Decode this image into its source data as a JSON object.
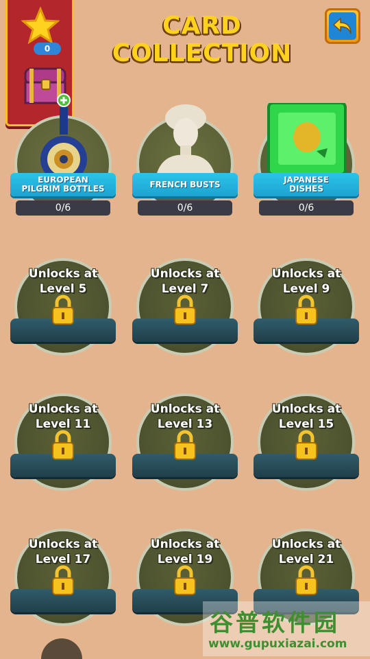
{
  "header": {
    "title_line1": "CARD",
    "title_line2": "COLLECTION",
    "back_icon": "back-arrow-icon"
  },
  "banner": {
    "star_count": "0",
    "chest_icon": "treasure-chest-icon"
  },
  "collections": [
    {
      "name_line1": "EUROPEAN",
      "name_line2": "PILGRIM BOTTLES",
      "progress": "0/6",
      "art": "pilgrim-bottle"
    },
    {
      "name_line1": "FRENCH BUSTS",
      "name_line2": "",
      "progress": "0/6",
      "art": "bust"
    },
    {
      "name_line1": "JAPANESE",
      "name_line2": "DISHES",
      "progress": "0/6",
      "art": "green-dish"
    }
  ],
  "locked": [
    {
      "line1": "Unlocks at",
      "line2": "Level 5"
    },
    {
      "line1": "Unlocks at",
      "line2": "Level 7"
    },
    {
      "line1": "Unlocks at",
      "line2": "Level 9"
    },
    {
      "line1": "Unlocks at",
      "line2": "Level 11"
    },
    {
      "line1": "Unlocks at",
      "line2": "Level 13"
    },
    {
      "line1": "Unlocks at",
      "line2": "Level 15"
    },
    {
      "line1": "Unlocks at",
      "line2": "Level 17"
    },
    {
      "line1": "Unlocks at",
      "line2": "Level 19"
    },
    {
      "line1": "Unlocks at",
      "line2": "Level 21"
    }
  ],
  "watermark": {
    "cn": "谷普软件园",
    "url": "www.gupuxiazai.com"
  }
}
